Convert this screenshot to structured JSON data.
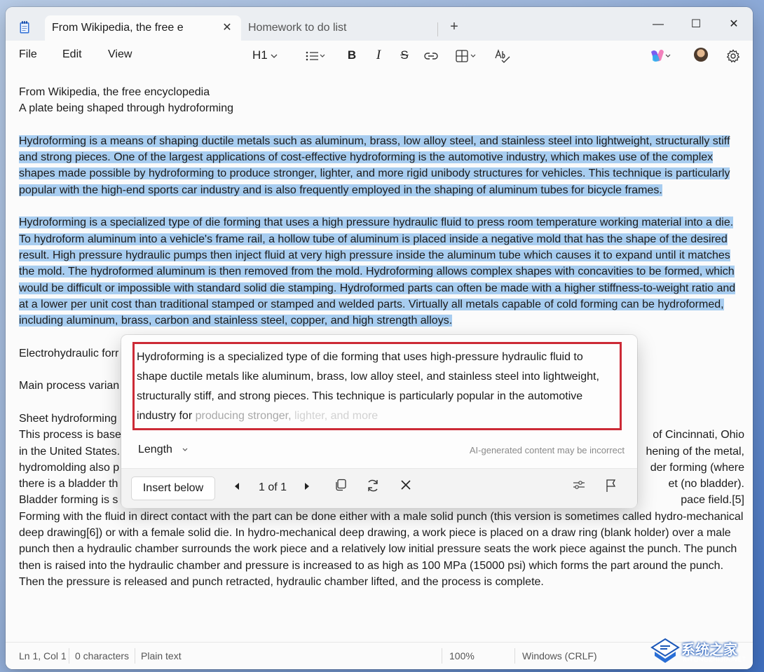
{
  "titlebar": {
    "active_tab": "From Wikipedia, the free e",
    "inactive_tab": "Homework to do list",
    "close_tab_glyph": "✕",
    "new_tab_glyph": "+",
    "minimize_glyph": "—",
    "maximize_glyph": "☐",
    "close_glyph": "✕"
  },
  "menu": {
    "file": "File",
    "edit": "Edit",
    "view": "View"
  },
  "toolbar": {
    "heading": "H1",
    "icons": [
      "heading-dropdown",
      "list-icon",
      "bold-icon",
      "italic-icon",
      "strikethrough-icon",
      "link-icon",
      "table-icon",
      "spellcheck-icon",
      "copilot-icon",
      "avatar",
      "gear-icon"
    ],
    "bold": "B",
    "italic": "I",
    "strike": "S"
  },
  "document": {
    "line1": "From Wikipedia, the free encyclopedia",
    "line2": "A plate being shaped through hydroforming",
    "para1": "Hydroforming is a means of shaping ductile metals such as aluminum, brass, low alloy steel, and stainless steel into lightweight, structurally stiff and strong pieces. One of the largest applications of cost-effective hydroforming is the automotive industry, which makes use of the complex shapes made possible by hydroforming to produce stronger, lighter, and more rigid unibody structures for vehicles. This technique is particularly popular with the high-end sports car industry and is also frequently employed in the shaping of aluminum tubes for bicycle frames.",
    "para2": "Hydroforming is a specialized type of die forming that uses a high pressure hydraulic fluid to press room temperature working material into a die. To hydroform aluminum into a vehicle's frame rail, a hollow tube of aluminum is placed inside a negative mold that has the shape of the desired result. High pressure hydraulic pumps then inject fluid at very high pressure inside the aluminum tube which causes it to expand until it matches the mold. The hydroformed aluminum is then removed from the mold. Hydroforming allows complex shapes with concavities to be formed, which would be difficult or impossible with standard solid die stamping. Hydroformed parts can often be made with a higher stiffness-to-weight ratio and at a lower per unit cost than traditional stamped or stamped and welded parts. Virtually all metals capable of cold forming can be hydroformed, including aluminum, brass, carbon and stainless steel, copper, and high strength alloys.",
    "line3": "Electrohydraulic forr",
    "line4": "Main process varian",
    "line5": "Sheet hydroforming",
    "para3_lines": [
      {
        "left": "This process is base",
        "right": "of Cincinnati, Ohio"
      },
      {
        "left": "in the United States.",
        "right": "hening of the metal,"
      },
      {
        "left": "hydromolding also p",
        "right": "der forming (where"
      },
      {
        "left": "there is a bladder th",
        "right": "et (no bladder)."
      },
      {
        "left": "Bladder forming is s",
        "right": "pace field.[5]"
      }
    ],
    "para3_rest": "Forming with the fluid in direct contact with the part can be done either with a male solid punch (this version is sometimes called hydro-mechanical deep drawing[6]) or with a female solid die. In hydro-mechanical deep drawing, a work piece is placed on a draw ring (blank holder) over a male punch then a hydraulic chamber surrounds the work piece and a relatively low initial pressure seats the work piece against the punch. The punch then is raised into the hydraulic chamber and pressure is increased to as high as 100 MPa (15000 psi) which forms the part around the punch. Then the pressure is released and punch retracted, hydraulic chamber lifted, and the process is complete."
  },
  "rewrite": {
    "suggestion_main": "Hydroforming is a specialized type of die forming that uses high-pressure hydraulic fluid to shape ductile metals like aluminum, brass, low alloy steel, and stainless steel into lightweight, structurally stiff, and strong pieces. This technique is particularly popular in the automotive industry for",
    "suggestion_fading": " producing stronger,",
    "suggestion_fading2": " lighter, and more",
    "length_label": "Length",
    "disclaimer": "AI-generated content may be incorrect",
    "insert_label": "Insert below",
    "page_indicator": "1 of 1",
    "icons": [
      "prev-arrow",
      "next-arrow",
      "copy-icon",
      "regenerate-icon",
      "close-icon",
      "settings-sliders-icon",
      "flag-icon"
    ],
    "highlight_color": "#cc2a36"
  },
  "status": {
    "position": "Ln 1, Col 1",
    "characters": "0 characters",
    "format": "Plain text",
    "zoom": "100%",
    "line_endings": "Windows (CRLF)"
  },
  "watermark": {
    "title": "系统之家",
    "url": "XITONGZHIJIA.NET"
  },
  "colors": {
    "selection": "#a8cdf0",
    "window": "#fbfbfb",
    "titlebar": "#ebeef2"
  }
}
